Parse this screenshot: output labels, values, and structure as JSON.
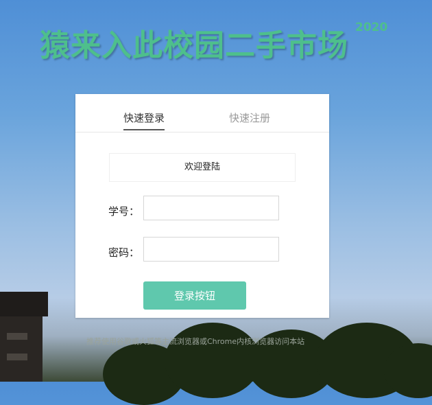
{
  "header": {
    "title": "猿来入此校园二手市场",
    "year": "2020"
  },
  "tabs": [
    {
      "label": "快速登录",
      "active": true
    },
    {
      "label": "快速注册",
      "active": false
    }
  ],
  "login": {
    "welcome": "欢迎登陆",
    "student_id_label": "学号：",
    "student_id_value": "",
    "password_label": "密码：",
    "password_value": "",
    "submit_label": "登录按钮"
  },
  "footer": {
    "hint": "推荐使用谷歌或火狐等主流浏览器或Chrome内核浏览器访问本站"
  },
  "colors": {
    "title": "#4ebf8c",
    "button": "#5fc8ad"
  }
}
